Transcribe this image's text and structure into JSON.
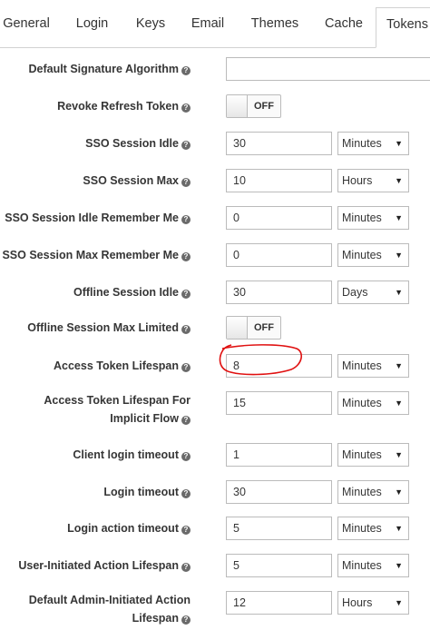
{
  "tabs": [
    "General",
    "Login",
    "Keys",
    "Email",
    "Themes",
    "Cache",
    "Tokens"
  ],
  "help_glyph": "?",
  "toggle_text": "OFF",
  "fields": {
    "default_signature_algorithm": {
      "label": "Default Signature Algorithm",
      "value": ""
    },
    "revoke_refresh_token": {
      "label": "Revoke Refresh Token",
      "state": "OFF"
    },
    "sso_session_idle": {
      "label": "SSO Session Idle",
      "value": "30",
      "unit": "Minutes"
    },
    "sso_session_max": {
      "label": "SSO Session Max",
      "value": "10",
      "unit": "Hours"
    },
    "sso_session_idle_remember_me": {
      "label": "SSO Session Idle Remember Me",
      "value": "0",
      "unit": "Minutes"
    },
    "sso_session_max_remember_me": {
      "label": "SSO Session Max Remember Me",
      "value": "0",
      "unit": "Minutes"
    },
    "offline_session_idle": {
      "label": "Offline Session Idle",
      "value": "30",
      "unit": "Days"
    },
    "offline_session_max_limited": {
      "label": "Offline Session Max Limited",
      "state": "OFF"
    },
    "access_token_lifespan": {
      "label": "Access Token Lifespan",
      "value": "8",
      "unit": "Minutes"
    },
    "access_token_lifespan_implicit": {
      "label": "Access Token Lifespan For Implicit Flow",
      "value": "15",
      "unit": "Minutes"
    },
    "client_login_timeout": {
      "label": "Client login timeout",
      "value": "1",
      "unit": "Minutes"
    },
    "login_timeout": {
      "label": "Login timeout",
      "value": "30",
      "unit": "Minutes"
    },
    "login_action_timeout": {
      "label": "Login action timeout",
      "value": "5",
      "unit": "Minutes"
    },
    "user_initiated_action_lifespan": {
      "label": "User-Initiated Action Lifespan",
      "value": "5",
      "unit": "Minutes"
    },
    "default_admin_initiated_action_lifespan": {
      "label": "Default Admin-Initiated Action Lifespan",
      "value": "12",
      "unit": "Hours"
    }
  },
  "colors": {
    "annotation": "#e01010"
  }
}
